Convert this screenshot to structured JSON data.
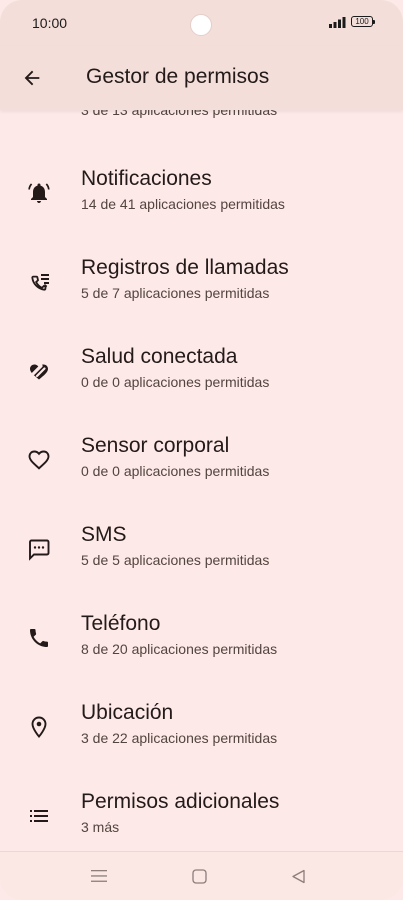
{
  "status_bar": {
    "time": "10:00",
    "battery": "100"
  },
  "app_bar": {
    "title": "Gestor de permisos",
    "back_icon": "arrow-back-icon"
  },
  "list": {
    "partial_top_subtitle": "3 de 13 aplicaciones permitidas",
    "items": [
      {
        "icon": "bell-icon",
        "title": "Notificaciones",
        "subtitle": "14 de 41 aplicaciones permitidas"
      },
      {
        "icon": "call-log-icon",
        "title": "Registros de llamadas",
        "subtitle": "5 de 7 aplicaciones permitidas"
      },
      {
        "icon": "connected-health-icon",
        "title": "Salud conectada",
        "subtitle": "0 de 0 aplicaciones permitidas"
      },
      {
        "icon": "heart-icon",
        "title": "Sensor corporal",
        "subtitle": "0 de 0 aplicaciones permitidas"
      },
      {
        "icon": "sms-icon",
        "title": "SMS",
        "subtitle": "5 de 5 aplicaciones permitidas"
      },
      {
        "icon": "phone-icon",
        "title": "Teléfono",
        "subtitle": "8 de 20 aplicaciones permitidas"
      },
      {
        "icon": "location-icon",
        "title": "Ubicación",
        "subtitle": "3 de 22 aplicaciones permitidas"
      },
      {
        "icon": "list-icon",
        "title": "Permisos adicionales",
        "subtitle": "3 más"
      }
    ]
  },
  "nav_bar": {
    "buttons": [
      "menu-icon",
      "home-icon",
      "back-triangle-icon"
    ]
  }
}
